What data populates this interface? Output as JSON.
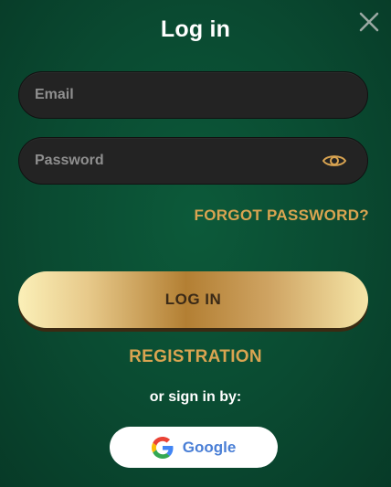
{
  "modal": {
    "title": "Log in",
    "close_icon": "close-icon"
  },
  "form": {
    "email": {
      "placeholder": "Email",
      "value": ""
    },
    "password": {
      "placeholder": "Password",
      "value": "",
      "toggle_icon": "eye-icon"
    },
    "forgot_label": "FORGOT PASSWORD?",
    "login_label": "LOG IN",
    "register_label": "REGISTRATION"
  },
  "social": {
    "prompt": "or sign in by:",
    "google_label": "Google",
    "google_icon": "google-icon"
  },
  "colors": {
    "background": "#0a4a31",
    "field_bg": "#232323",
    "accent_gold": "#d9a451",
    "google_text": "#4a7fd6"
  }
}
